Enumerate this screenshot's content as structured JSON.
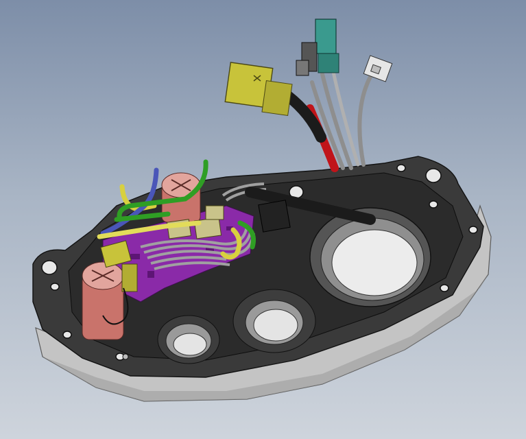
{
  "scene": {
    "subject": "",
    "background_top": "#7d8ea8",
    "background_bottom": "#ced4dc"
  },
  "colors": {
    "plate_top": "#2a2a2a",
    "plate_side": "#bdbdbd",
    "cable_red": "#c0141a",
    "wire_yellow": "#d8d040",
    "wire_green": "#2f9e24",
    "wire_blue": "#4a56b8",
    "connector_yellow": "#c8c33a",
    "connector_teal": "#3a9a8e",
    "capacitor_pink": "#d98a82",
    "pcb_purple": "#8a2aa8",
    "wire_loom_grey": "#a0a0a0"
  }
}
